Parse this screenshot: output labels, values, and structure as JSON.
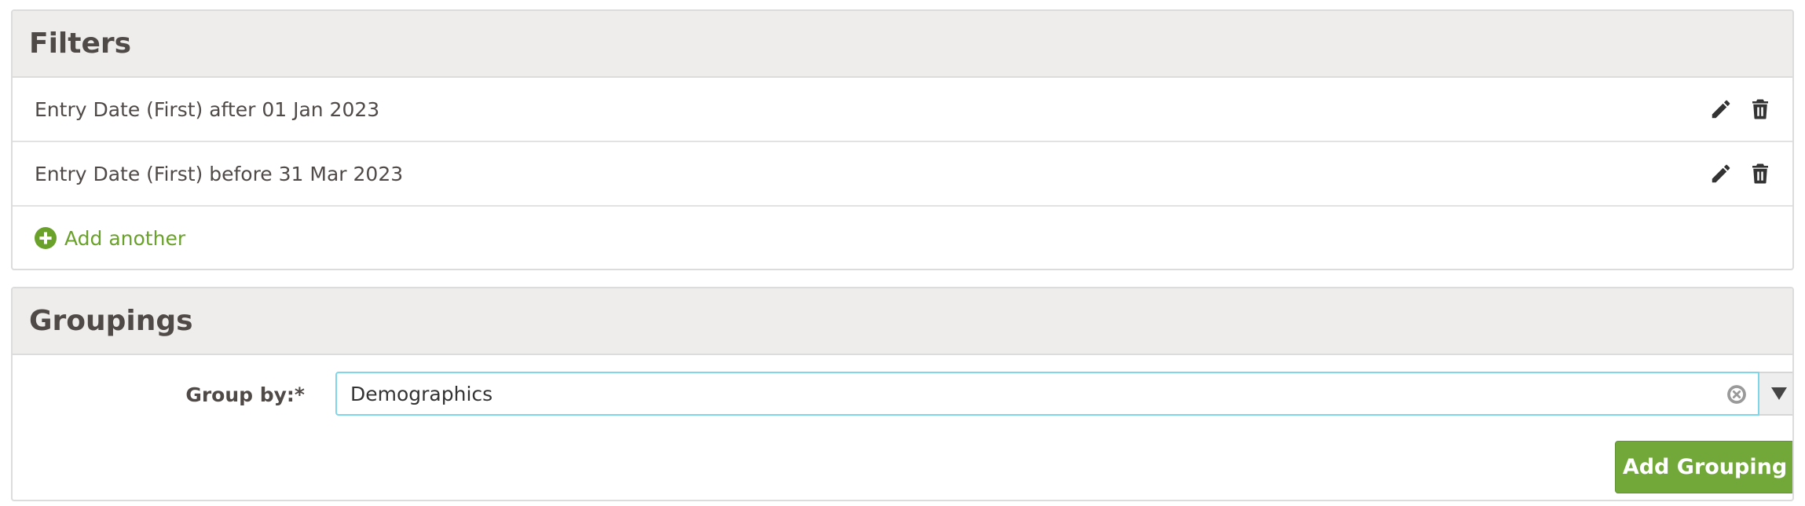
{
  "filters": {
    "title": "Filters",
    "items": [
      {
        "text": "Entry Date (First) after 01 Jan 2023"
      },
      {
        "text": "Entry Date (First) before 31 Mar 2023"
      }
    ],
    "add_label": "Add another"
  },
  "groupings": {
    "title": "Groupings",
    "group_by_label": "Group by:*",
    "group_by_value": "Demographics",
    "add_button_label": "Add Grouping"
  },
  "icons": {
    "edit": "pencil-icon",
    "delete": "trash-icon",
    "add": "plus-circle-icon",
    "clear": "clear-circle-icon",
    "dropdown": "triangle-down-icon"
  },
  "colors": {
    "accent_green": "#6aa12b",
    "button_green": "#72a83a",
    "focus_border": "#7fd6e8",
    "header_bg": "#eeedeb"
  }
}
